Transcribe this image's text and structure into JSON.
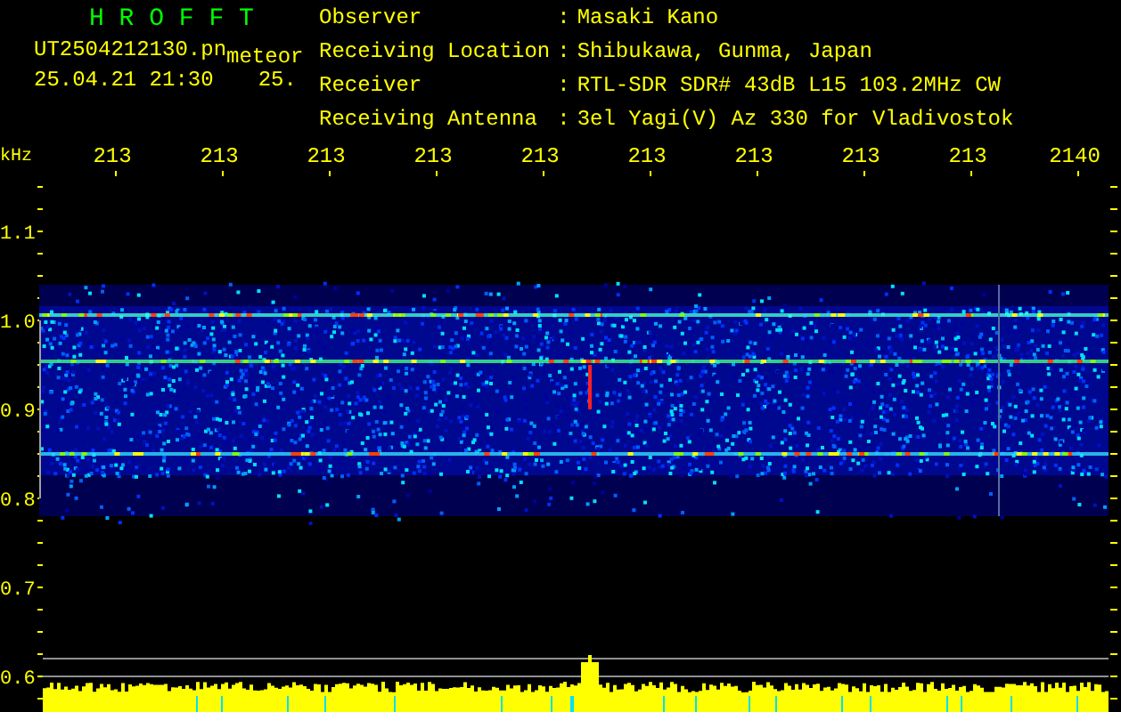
{
  "app_title": "H R O F F T",
  "file_name": "UT2504212130.pn",
  "mode_label": "meteor",
  "timestamp": "25.04.21 21:30",
  "count": "25.",
  "station": [
    {
      "label": "Observer",
      "separator": ":",
      "value": "Masaki Kano"
    },
    {
      "label": "Receiving Location",
      "separator": ":",
      "value": "Shibukawa, Gunma, Japan"
    },
    {
      "label": "Receiver",
      "separator": ":",
      "value": "RTL-SDR SDR# 43dB L15 103.2MHz CW"
    },
    {
      "label": "Receiving Antenna",
      "separator": ":",
      "value": "3el Yagi(V) Az 330 for Vladivostok"
    }
  ],
  "plot": {
    "y_unit": "kHz",
    "x_labels": [
      "213",
      "213",
      "213",
      "213",
      "213",
      "213",
      "213",
      "213",
      "213",
      "2140"
    ],
    "y_labels": [
      "1.1",
      "1.0",
      "0.9",
      "0.8",
      "0.7",
      "0.6"
    ]
  }
}
